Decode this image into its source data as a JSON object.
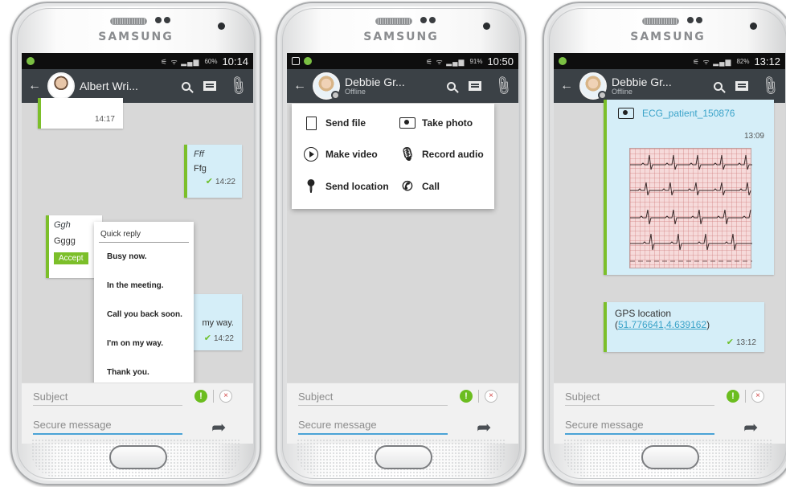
{
  "device": {
    "brand": "SAMSUNG"
  },
  "input": {
    "subject_placeholder": "Subject",
    "message_placeholder": "Secure message",
    "priority_symbol": "!",
    "cancel_symbol": "×"
  },
  "screens": [
    {
      "status_time": "10:14",
      "battery": "60%",
      "contact": {
        "name": "Albert Wri...",
        "subtitle": ""
      },
      "messages": {
        "time_top": "14:17",
        "out1": {
          "sender": "Fff",
          "text": "Ffg",
          "time": "14:22"
        },
        "in1": {
          "sender": "Ggh",
          "text": "Gggg",
          "button": "Accept"
        },
        "out2": {
          "text": "my way.",
          "time": "14:22"
        }
      },
      "quick_reply": {
        "title": "Quick reply",
        "items": [
          "Busy now.",
          "In the meeting.",
          "Call you back soon.",
          "I'm on my way.",
          "Thank you."
        ]
      }
    },
    {
      "status_time": "10:50",
      "battery": "91%",
      "contact": {
        "name": "Debbie Gr...",
        "subtitle": "Offline"
      },
      "attach_menu": {
        "send_file": "Send file",
        "take_photo": "Take photo",
        "make_video": "Make video",
        "record_audio": "Record audio",
        "send_location": "Send location",
        "call": "Call"
      }
    },
    {
      "status_time": "13:12",
      "battery": "82%",
      "contact": {
        "name": "Debbie Gr...",
        "subtitle": "Offline"
      },
      "messages": {
        "file_name": "ECG_patient_150876",
        "file_time": "13:09",
        "gps_label": "GPS location",
        "gps_coords": "51.776641,4.639162",
        "gps_time": "13:12"
      }
    }
  ]
}
